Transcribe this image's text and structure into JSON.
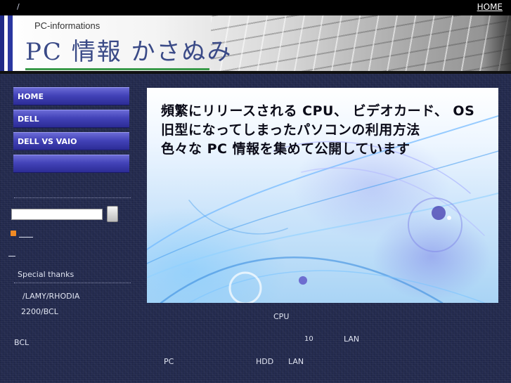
{
  "topbar": {
    "breadcrumb": "/",
    "home_link": "HOME"
  },
  "header": {
    "subtitle": "PC-informations",
    "title": "PC 情報 かさぬみ"
  },
  "nav": {
    "items": [
      {
        "label": "HOME"
      },
      {
        "label": "DELL"
      },
      {
        "label": "DELL VS VAIO"
      },
      {
        "label": ""
      }
    ]
  },
  "search": {
    "value": "",
    "button_label": ""
  },
  "sidebar": {
    "special_thanks": "Special thanks",
    "links": [
      "/LAMY/RHODIA",
      "2200/BCL"
    ],
    "bcl": "BCL"
  },
  "banner": {
    "lines": [
      "頻繁にリリースされる CPU、 ビデオカード、 OS",
      "旧型になってしまったパソコンの利用方法",
      "色々な PC 情報を集めて公開しています"
    ]
  },
  "main": {
    "frag_cpu": "CPU",
    "frag_10": "10",
    "frag_lan1": "LAN",
    "frag_pc": "PC",
    "frag_hdd": "HDD",
    "frag_lan2": "LAN"
  },
  "colors": {
    "nav_button": "#4343b8",
    "background": "#232a4e",
    "header_stripe": "#1f2a86"
  },
  "icons": {
    "rss": "rss-feed-icon"
  }
}
